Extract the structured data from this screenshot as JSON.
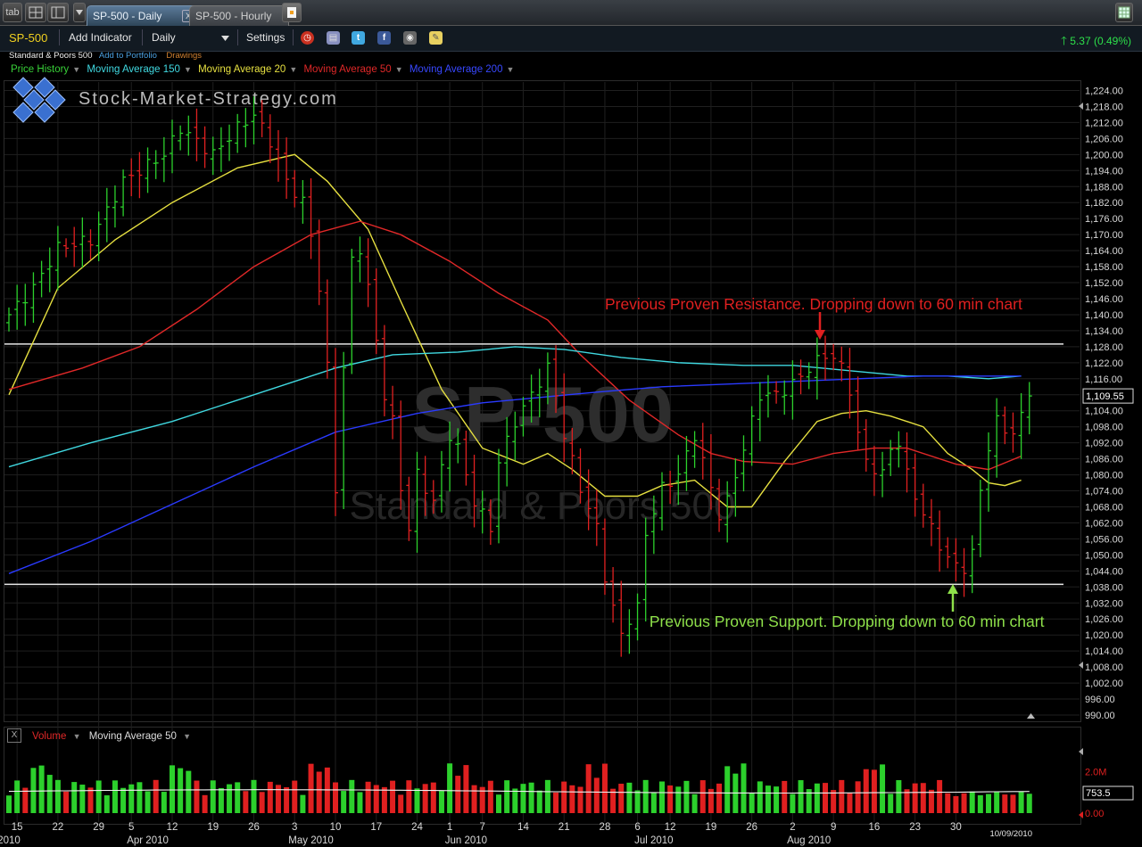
{
  "window": {
    "tab_button": "tab",
    "tabs": [
      {
        "label": "SP-500 - Daily",
        "active": true
      },
      {
        "label": "SP-500 - Hourly",
        "active": false
      }
    ]
  },
  "toolbar": {
    "symbol": "SP-500",
    "add_indicator": "Add Indicator",
    "interval": "Daily",
    "settings": "Settings",
    "change": "5.37 (0.49%)",
    "icons": [
      "alarm-clock-icon",
      "layers-icon",
      "twitter-icon",
      "facebook-icon",
      "camera-icon",
      "note-icon"
    ]
  },
  "subheader": {
    "name": "Standard & Poors 500",
    "add_to_portfolio": "Add to Portfolio",
    "drawings": "Drawings"
  },
  "overlays": [
    {
      "label": "Price History",
      "color": "#38d038"
    },
    {
      "label": "Moving Average 150",
      "color": "#40d8e0"
    },
    {
      "label": "Moving Average 20",
      "color": "#e6e040"
    },
    {
      "label": "Moving Average 50",
      "color": "#e02828"
    },
    {
      "label": "Moving Average 200",
      "color": "#2a3aff"
    }
  ],
  "logo_text": "Stock-Market-Strategy.com",
  "watermark": {
    "line1": "SP-500",
    "line2": "Standard & Poors 500"
  },
  "volume_panel": {
    "label": "Volume",
    "ma_label": "Moving Average 50",
    "last_label": "753.5",
    "y_ticks": [
      "2.0M",
      "0.00"
    ]
  },
  "date_stamp": "10/09/2010",
  "chart_data": {
    "type": "ohlc",
    "title": "SP-500",
    "ylim": [
      985,
      1230
    ],
    "y_ticks": [
      "1,224.00",
      "1,218.00",
      "1,212.00",
      "1,206.00",
      "1,200.00",
      "1,194.00",
      "1,188.00",
      "1,182.00",
      "1,176.00",
      "1,170.00",
      "1,164.00",
      "1,158.00",
      "1,152.00",
      "1,146.00",
      "1,140.00",
      "1,134.00",
      "1,128.00",
      "1,122.00",
      "1,116.00",
      "1,110.00",
      "1,104.00",
      "1,098.00",
      "1,092.00",
      "1,086.00",
      "1,080.00",
      "1,074.00",
      "1,068.00",
      "1,062.00",
      "1,056.00",
      "1,050.00",
      "1,044.00",
      "1,038.00",
      "1,032.00",
      "1,026.00",
      "1,020.00",
      "1,014.00",
      "1,008.00",
      "1,002.00",
      "996.00",
      "990.00"
    ],
    "last_price_label": "1,109.55",
    "last_price": 1109.55,
    "x_ticks": [
      {
        "label": "15",
        "i": 1
      },
      {
        "label": "22",
        "i": 6
      },
      {
        "label": "29",
        "i": 11
      },
      {
        "label": "5",
        "i": 15
      },
      {
        "label": "12",
        "i": 20
      },
      {
        "label": "19",
        "i": 25
      },
      {
        "label": "26",
        "i": 30
      },
      {
        "label": "3",
        "i": 35
      },
      {
        "label": "10",
        "i": 40
      },
      {
        "label": "17",
        "i": 45
      },
      {
        "label": "24",
        "i": 50
      },
      {
        "label": "1",
        "i": 54
      },
      {
        "label": "7",
        "i": 58
      },
      {
        "label": "14",
        "i": 63
      },
      {
        "label": "21",
        "i": 68
      },
      {
        "label": "28",
        "i": 73
      },
      {
        "label": "6",
        "i": 77
      },
      {
        "label": "12",
        "i": 81
      },
      {
        "label": "19",
        "i": 86
      },
      {
        "label": "26",
        "i": 91
      },
      {
        "label": "2",
        "i": 96
      },
      {
        "label": "9",
        "i": 101
      },
      {
        "label": "16",
        "i": 106
      },
      {
        "label": "23",
        "i": 111
      },
      {
        "label": "30",
        "i": 116
      }
    ],
    "x_month_labels": [
      {
        "label": "2010",
        "i": 0
      },
      {
        "label": "Apr 2010",
        "i": 17
      },
      {
        "label": "May 2010",
        "i": 37
      },
      {
        "label": "Jun 2010",
        "i": 56
      },
      {
        "label": "Jul 2010",
        "i": 79
      },
      {
        "label": "Aug 2010",
        "i": 98
      }
    ],
    "close_anchors": [
      [
        0,
        1140
      ],
      [
        3,
        1150
      ],
      [
        6,
        1165
      ],
      [
        10,
        1168
      ],
      [
        14,
        1190
      ],
      [
        17,
        1196
      ],
      [
        19,
        1200
      ],
      [
        21,
        1210
      ],
      [
        23,
        1205
      ],
      [
        25,
        1200
      ],
      [
        28,
        1210
      ],
      [
        30,
        1215
      ],
      [
        32,
        1205
      ],
      [
        34,
        1190
      ],
      [
        36,
        1182
      ],
      [
        37,
        1170
      ],
      [
        38,
        1150
      ],
      [
        39,
        1120
      ],
      [
        40,
        1075
      ],
      [
        41,
        1120
      ],
      [
        42,
        1160
      ],
      [
        43,
        1165
      ],
      [
        44,
        1150
      ],
      [
        45,
        1130
      ],
      [
        46,
        1110
      ],
      [
        47,
        1100
      ],
      [
        48,
        1075
      ],
      [
        49,
        1060
      ],
      [
        50,
        1080
      ],
      [
        52,
        1070
      ],
      [
        54,
        1095
      ],
      [
        55,
        1090
      ],
      [
        57,
        1070
      ],
      [
        59,
        1060
      ],
      [
        60,
        1085
      ],
      [
        62,
        1100
      ],
      [
        64,
        1110
      ],
      [
        66,
        1120
      ],
      [
        67,
        1110
      ],
      [
        68,
        1095
      ],
      [
        70,
        1075
      ],
      [
        72,
        1060
      ],
      [
        73,
        1042
      ],
      [
        74,
        1030
      ],
      [
        75,
        1020
      ],
      [
        76,
        1026
      ],
      [
        77,
        1030
      ],
      [
        78,
        1058
      ],
      [
        80,
        1075
      ],
      [
        82,
        1080
      ],
      [
        84,
        1095
      ],
      [
        86,
        1075
      ],
      [
        87,
        1065
      ],
      [
        88,
        1070
      ],
      [
        90,
        1090
      ],
      [
        92,
        1110
      ],
      [
        94,
        1110
      ],
      [
        96,
        1114
      ],
      [
        98,
        1120
      ],
      [
        100,
        1125
      ],
      [
        101,
        1124
      ],
      [
        102,
        1120
      ],
      [
        103,
        1112
      ],
      [
        104,
        1095
      ],
      [
        105,
        1085
      ],
      [
        107,
        1080
      ],
      [
        108,
        1090
      ],
      [
        109,
        1092
      ],
      [
        110,
        1080
      ],
      [
        112,
        1065
      ],
      [
        113,
        1060
      ],
      [
        115,
        1048
      ],
      [
        117,
        1045
      ],
      [
        118,
        1050
      ],
      [
        119,
        1075
      ],
      [
        120,
        1090
      ],
      [
        121,
        1100
      ],
      [
        123,
        1095
      ],
      [
        124,
        1102
      ],
      [
        125,
        1110
      ]
    ],
    "series_ma": [
      {
        "name": "Moving Average 20",
        "color": "#e6e040",
        "points": [
          [
            0,
            1110
          ],
          [
            6,
            1150
          ],
          [
            13,
            1168
          ],
          [
            20,
            1182
          ],
          [
            28,
            1195
          ],
          [
            35,
            1200
          ],
          [
            39,
            1190
          ],
          [
            44,
            1172
          ],
          [
            48,
            1145
          ],
          [
            53,
            1112
          ],
          [
            58,
            1090
          ],
          [
            63,
            1084
          ],
          [
            66,
            1088
          ],
          [
            69,
            1082
          ],
          [
            73,
            1072
          ],
          [
            77,
            1072
          ],
          [
            80,
            1076
          ],
          [
            84,
            1078
          ],
          [
            88,
            1068
          ],
          [
            91,
            1068
          ],
          [
            95,
            1085
          ],
          [
            99,
            1100
          ],
          [
            102,
            1103
          ],
          [
            105,
            1104
          ],
          [
            108,
            1102
          ],
          [
            112,
            1098
          ],
          [
            115,
            1088
          ],
          [
            118,
            1082
          ],
          [
            120,
            1077
          ],
          [
            122,
            1076
          ],
          [
            124,
            1078
          ]
        ]
      },
      {
        "name": "Moving Average 50",
        "color": "#e02828",
        "points": [
          [
            0,
            1112
          ],
          [
            9,
            1120
          ],
          [
            16,
            1128
          ],
          [
            23,
            1142
          ],
          [
            30,
            1158
          ],
          [
            37,
            1170
          ],
          [
            43,
            1175
          ],
          [
            48,
            1170
          ],
          [
            54,
            1160
          ],
          [
            60,
            1148
          ],
          [
            66,
            1138
          ],
          [
            70,
            1125
          ],
          [
            76,
            1108
          ],
          [
            82,
            1095
          ],
          [
            86,
            1088
          ],
          [
            90,
            1085
          ],
          [
            96,
            1084
          ],
          [
            101,
            1088
          ],
          [
            106,
            1090
          ],
          [
            110,
            1090
          ],
          [
            116,
            1084
          ],
          [
            120,
            1082
          ],
          [
            124,
            1087
          ]
        ]
      },
      {
        "name": "Moving Average 150",
        "color": "#40d8e0",
        "points": [
          [
            0,
            1083
          ],
          [
            10,
            1092
          ],
          [
            20,
            1100
          ],
          [
            30,
            1110
          ],
          [
            40,
            1120
          ],
          [
            47,
            1125
          ],
          [
            55,
            1126
          ],
          [
            62,
            1128
          ],
          [
            68,
            1127
          ],
          [
            75,
            1124
          ],
          [
            82,
            1122
          ],
          [
            90,
            1121
          ],
          [
            96,
            1121
          ],
          [
            103,
            1119
          ],
          [
            110,
            1117
          ],
          [
            115,
            1117
          ],
          [
            120,
            1116
          ],
          [
            124,
            1117
          ]
        ]
      },
      {
        "name": "Moving Average 200",
        "color": "#2a3aff",
        "points": [
          [
            0,
            1043
          ],
          [
            10,
            1055
          ],
          [
            20,
            1069
          ],
          [
            30,
            1083
          ],
          [
            40,
            1096
          ],
          [
            50,
            1103
          ],
          [
            58,
            1107
          ],
          [
            65,
            1109
          ],
          [
            72,
            1111
          ],
          [
            80,
            1113
          ],
          [
            88,
            1114
          ],
          [
            96,
            1115
          ],
          [
            104,
            1116
          ],
          [
            112,
            1117
          ],
          [
            120,
            1117
          ],
          [
            124,
            1117
          ]
        ]
      }
    ],
    "horizontal_lines": [
      1129,
      1039
    ],
    "annotations": [
      {
        "text": "Previous Proven Resistance. Dropping down to 60 min chart",
        "color": "#e02020",
        "price": 1144,
        "i": 73
      },
      {
        "text": "Previous Proven Support. Dropping down to 60 min chart",
        "color": "#8ee04a",
        "price": 1025,
        "i": 79
      }
    ],
    "volume": {
      "ylim": [
        0,
        2.5
      ],
      "ma_level": 1.05
    }
  }
}
